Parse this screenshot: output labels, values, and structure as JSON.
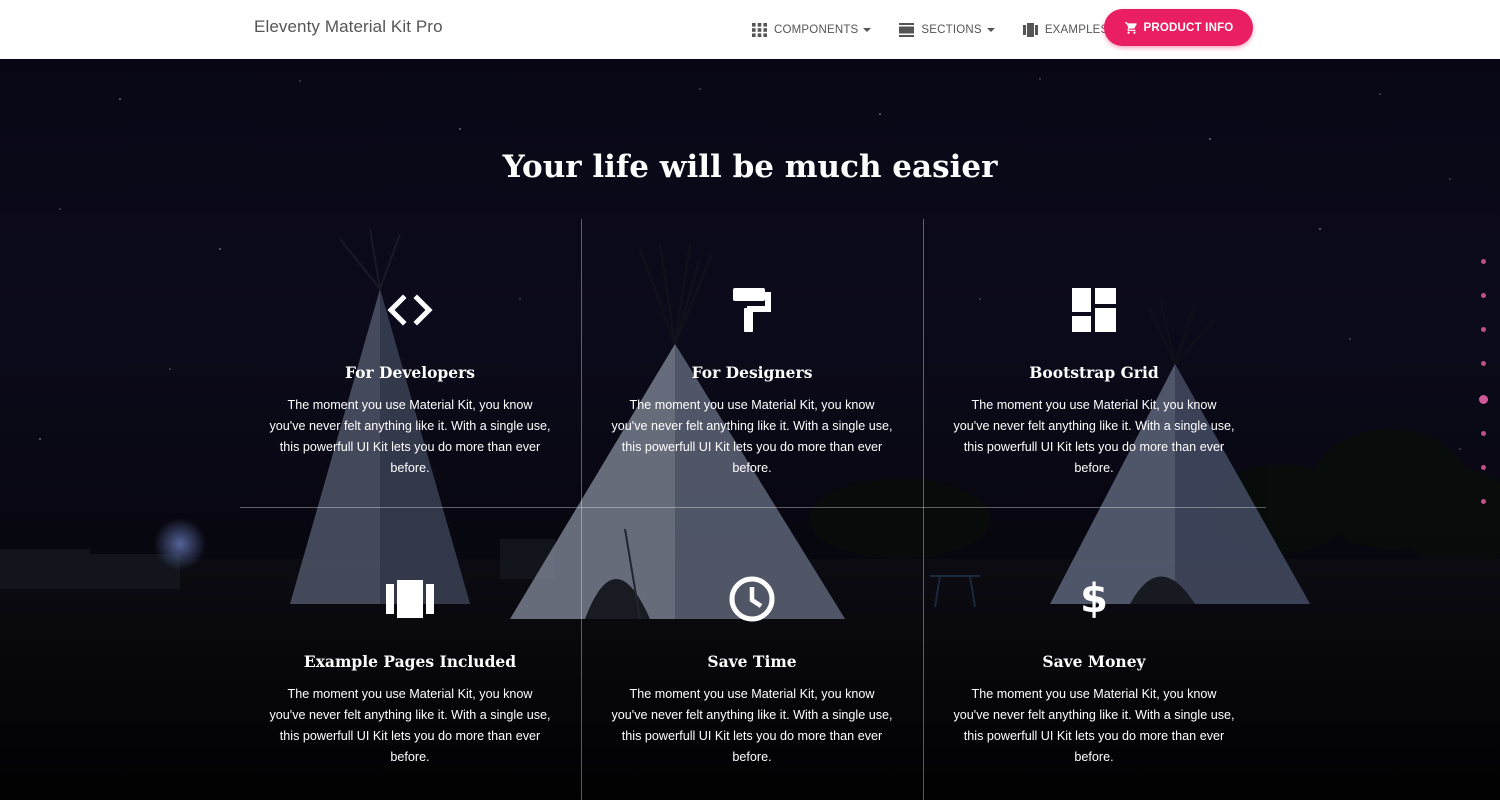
{
  "navbar": {
    "brand": "Eleventy Material Kit Pro",
    "items": [
      {
        "label": "Components",
        "icon": "apps-icon"
      },
      {
        "label": "Sections",
        "icon": "view-day-icon"
      },
      {
        "label": "Examples",
        "icon": "view-carousel-icon"
      }
    ],
    "cta": {
      "label": "Product Info",
      "icon": "shopping-cart-icon"
    }
  },
  "hero": {
    "title": "Your life will be much easier",
    "features": [
      {
        "title": "For Developers",
        "icon": "code-icon",
        "text": "The moment you use Material Kit, you know you've never felt anything like it. With a single use, this powerfull UI Kit lets you do more than ever before."
      },
      {
        "title": "For Designers",
        "icon": "format-paint-icon",
        "text": "The moment you use Material Kit, you know you've never felt anything like it. With a single use, this powerfull UI Kit lets you do more than ever before."
      },
      {
        "title": "Bootstrap Grid",
        "icon": "dashboard-icon",
        "text": "The moment you use Material Kit, you know you've never felt anything like it. With a single use, this powerfull UI Kit lets you do more than ever before."
      },
      {
        "title": "Example Pages Included",
        "icon": "view-carousel-icon",
        "text": "The moment you use Material Kit, you know you've never felt anything like it. With a single use, this powerfull UI Kit lets you do more than ever before."
      },
      {
        "title": "Save Time",
        "icon": "clock-icon",
        "text": "The moment you use Material Kit, you know you've never felt anything like it. With a single use, this powerfull UI Kit lets you do more than ever before."
      },
      {
        "title": "Save Money",
        "icon": "dollar-icon",
        "text": "The moment you use Material Kit, you know you've never felt anything like it. With a single use, this powerfull UI Kit lets you do more than ever before."
      }
    ]
  },
  "colors": {
    "accent": "#e91e63",
    "dot": "#c0508a"
  },
  "section_nav": {
    "count": 8,
    "active_index": 4
  }
}
